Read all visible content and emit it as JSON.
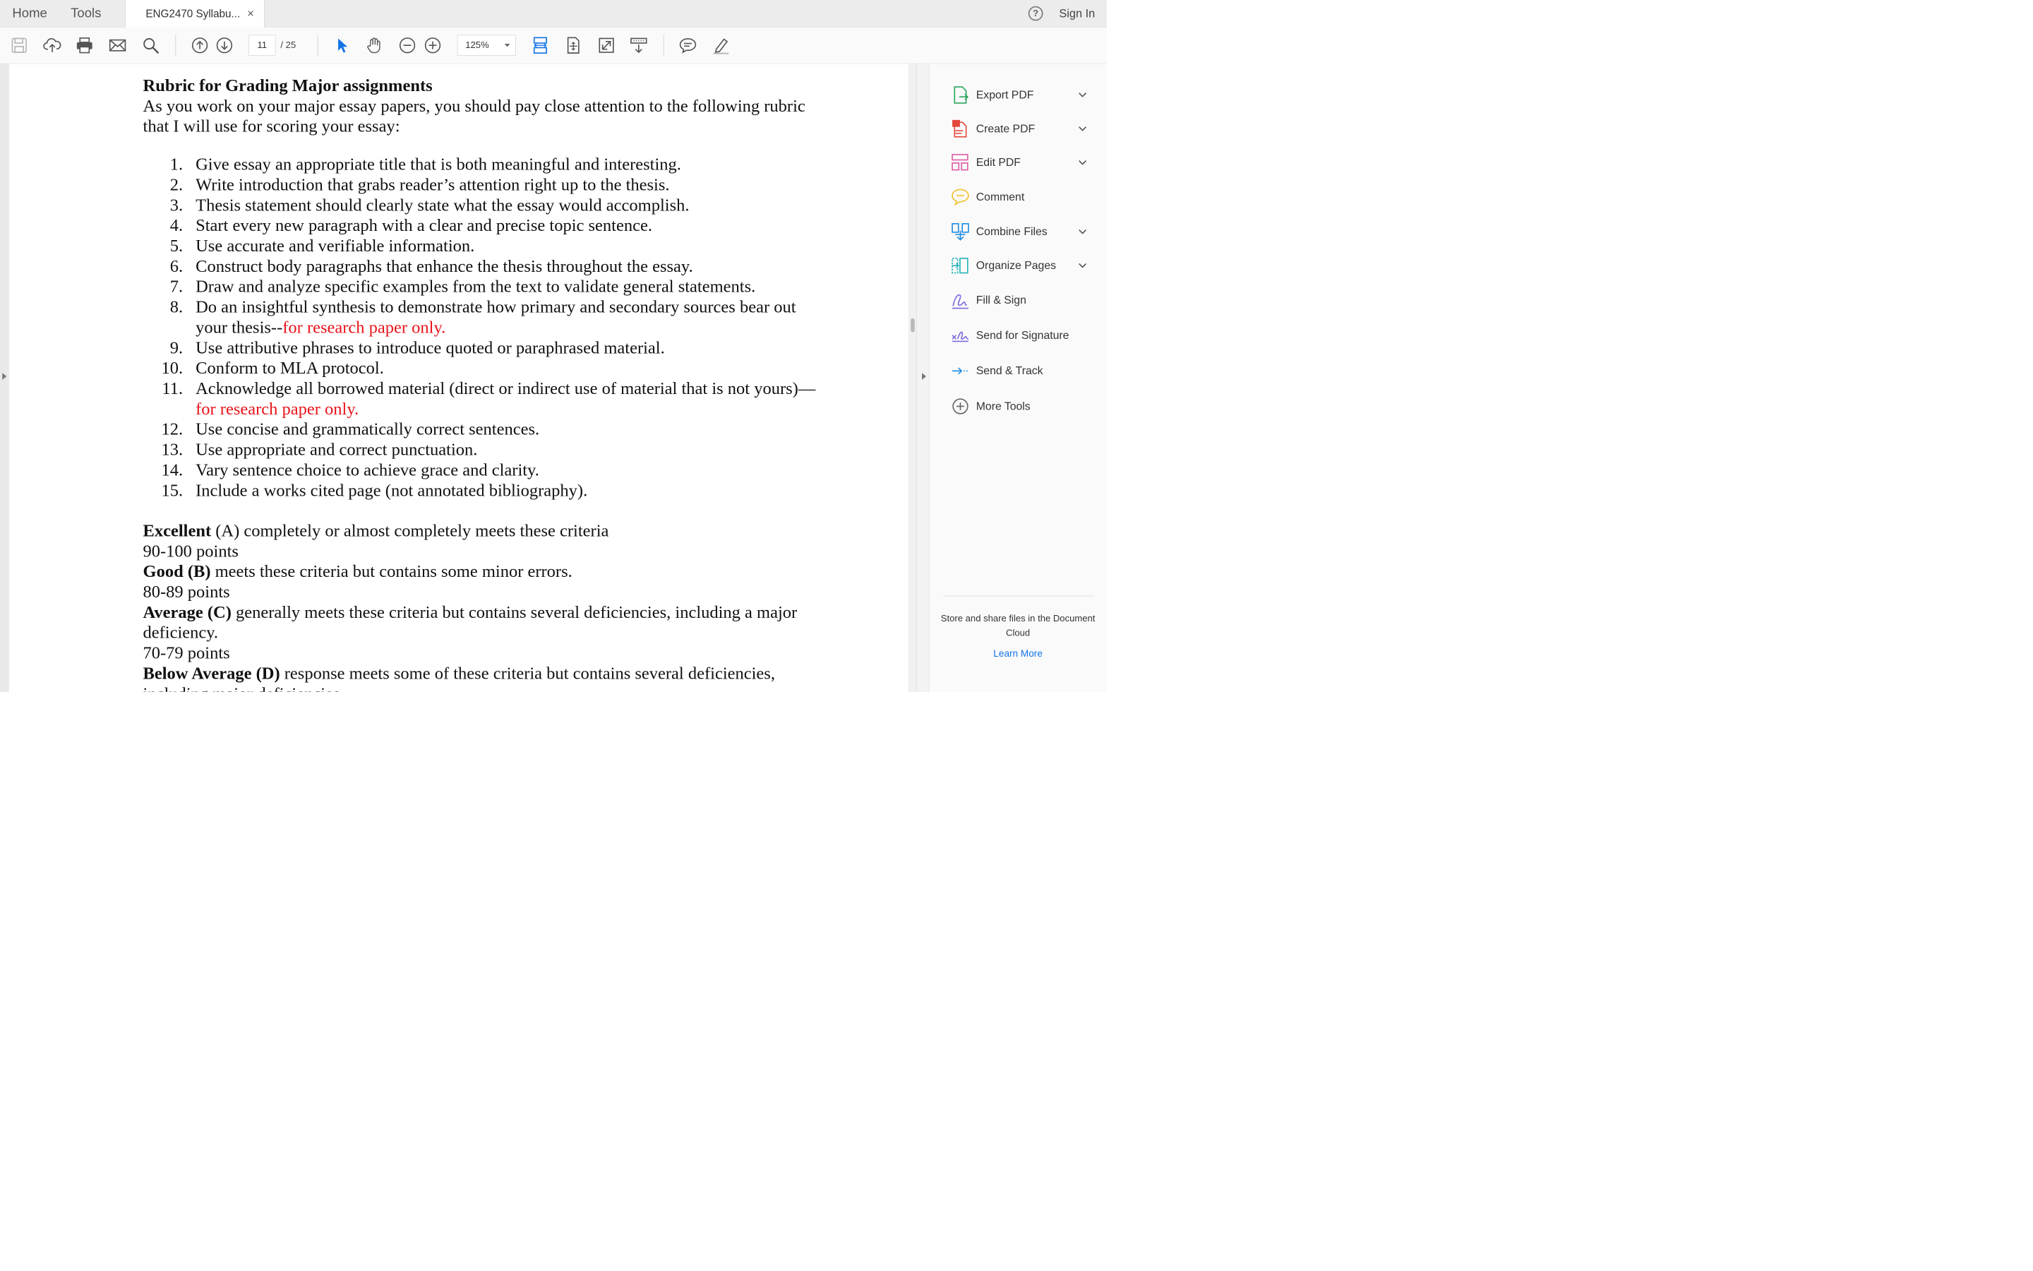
{
  "tabbar": {
    "home": "Home",
    "tools": "Tools",
    "doc_tab_title": "ENG2470 Syllabu...",
    "close": "×",
    "help": "?",
    "sign_in": "Sign In"
  },
  "toolbar": {
    "current_page": "11",
    "total_pages": "/ 25",
    "zoom": "125%",
    "accent_color": "#1473e6"
  },
  "document": {
    "heading": "Rubric for Grading Major assignments",
    "intro": "As you work on your major essay papers, you should pay close attention to the following rubric that I will use for scoring your essay:",
    "items": [
      {
        "num": "1.",
        "text": "Give essay an appropriate title that is both meaningful and interesting.",
        "note": ""
      },
      {
        "num": "2.",
        "text": "Write introduction that grabs reader’s attention right up to the thesis.",
        "note": ""
      },
      {
        "num": "3.",
        "text": "Thesis statement should clearly state what the essay would accomplish.",
        "note": ""
      },
      {
        "num": "4.",
        "text": "Start every new paragraph with a clear and precise topic sentence.",
        "note": ""
      },
      {
        "num": "5.",
        "text": "Use accurate and verifiable information.",
        "note": ""
      },
      {
        "num": "6.",
        "text": "Construct body paragraphs that enhance the thesis throughout the essay.",
        "note": ""
      },
      {
        "num": "7.",
        "text": "Draw and analyze specific examples from the text to validate general statements.",
        "note": ""
      },
      {
        "num": "8.",
        "text": "Do an insightful synthesis to demonstrate how primary and secondary sources bear out your thesis--",
        "note": "for research paper only."
      },
      {
        "num": "9.",
        "text": "Use attributive phrases to introduce quoted or paraphrased material.",
        "note": ""
      },
      {
        "num": "10.",
        "text": "Conform to MLA protocol.",
        "note": ""
      },
      {
        "num": "11.",
        "text": "Acknowledge all borrowed material (direct or indirect use of material that is not yours)—",
        "note": "for research paper only."
      },
      {
        "num": "12.",
        "text": "Use concise and grammatically correct sentences.",
        "note": ""
      },
      {
        "num": "13.",
        "text": "Use appropriate and correct punctuation.",
        "note": ""
      },
      {
        "num": "14.",
        "text": "Vary sentence choice to achieve grace and clarity.",
        "note": ""
      },
      {
        "num": "15.",
        "text": "Include a works cited page (not annotated bibliography).",
        "note": ""
      }
    ],
    "grades": [
      {
        "label": "Excellent",
        "rest": " (A) completely or almost completely meets these criteria",
        "points": "90-100 points"
      },
      {
        "label": "Good (B)",
        "rest": " meets these criteria but contains some minor errors.",
        "points": "80-89 points"
      },
      {
        "label": "Average (C)",
        "rest": " generally meets these criteria but contains several deficiencies, including a major deficiency.",
        "points": "70-79 points"
      },
      {
        "label": "Below Average (D)",
        "rest": " response meets some of these criteria but contains several deficiencies, including major deficiencies",
        "points": ""
      }
    ]
  },
  "right_panel": {
    "items": [
      {
        "label": "Export PDF",
        "icon": "export-pdf-icon",
        "color": "#2ba55e"
      },
      {
        "label": "Create PDF",
        "icon": "create-pdf-icon",
        "color": "#e3493b"
      },
      {
        "label": "Edit PDF",
        "icon": "edit-pdf-icon",
        "color": "#e05ca6"
      },
      {
        "label": "Comment",
        "icon": "comment-icon",
        "color": "#f2c12e"
      },
      {
        "label": "Combine Files",
        "icon": "combine-files-icon",
        "color": "#1f8de0"
      },
      {
        "label": "Organize Pages",
        "icon": "organize-pages-icon",
        "color": "#27b4b8"
      },
      {
        "label": "Fill & Sign",
        "icon": "fill-sign-icon",
        "color": "#7b6ae0"
      },
      {
        "label": "Send for Signature",
        "icon": "send-signature-icon",
        "color": "#7b6ae0"
      },
      {
        "label": "Send & Track",
        "icon": "send-track-icon",
        "color": "#1f8de0"
      },
      {
        "label": "More Tools",
        "icon": "more-tools-icon",
        "color": "#666666"
      }
    ],
    "promo": "Store and share files in the Document Cloud",
    "learn_more": "Learn More"
  }
}
